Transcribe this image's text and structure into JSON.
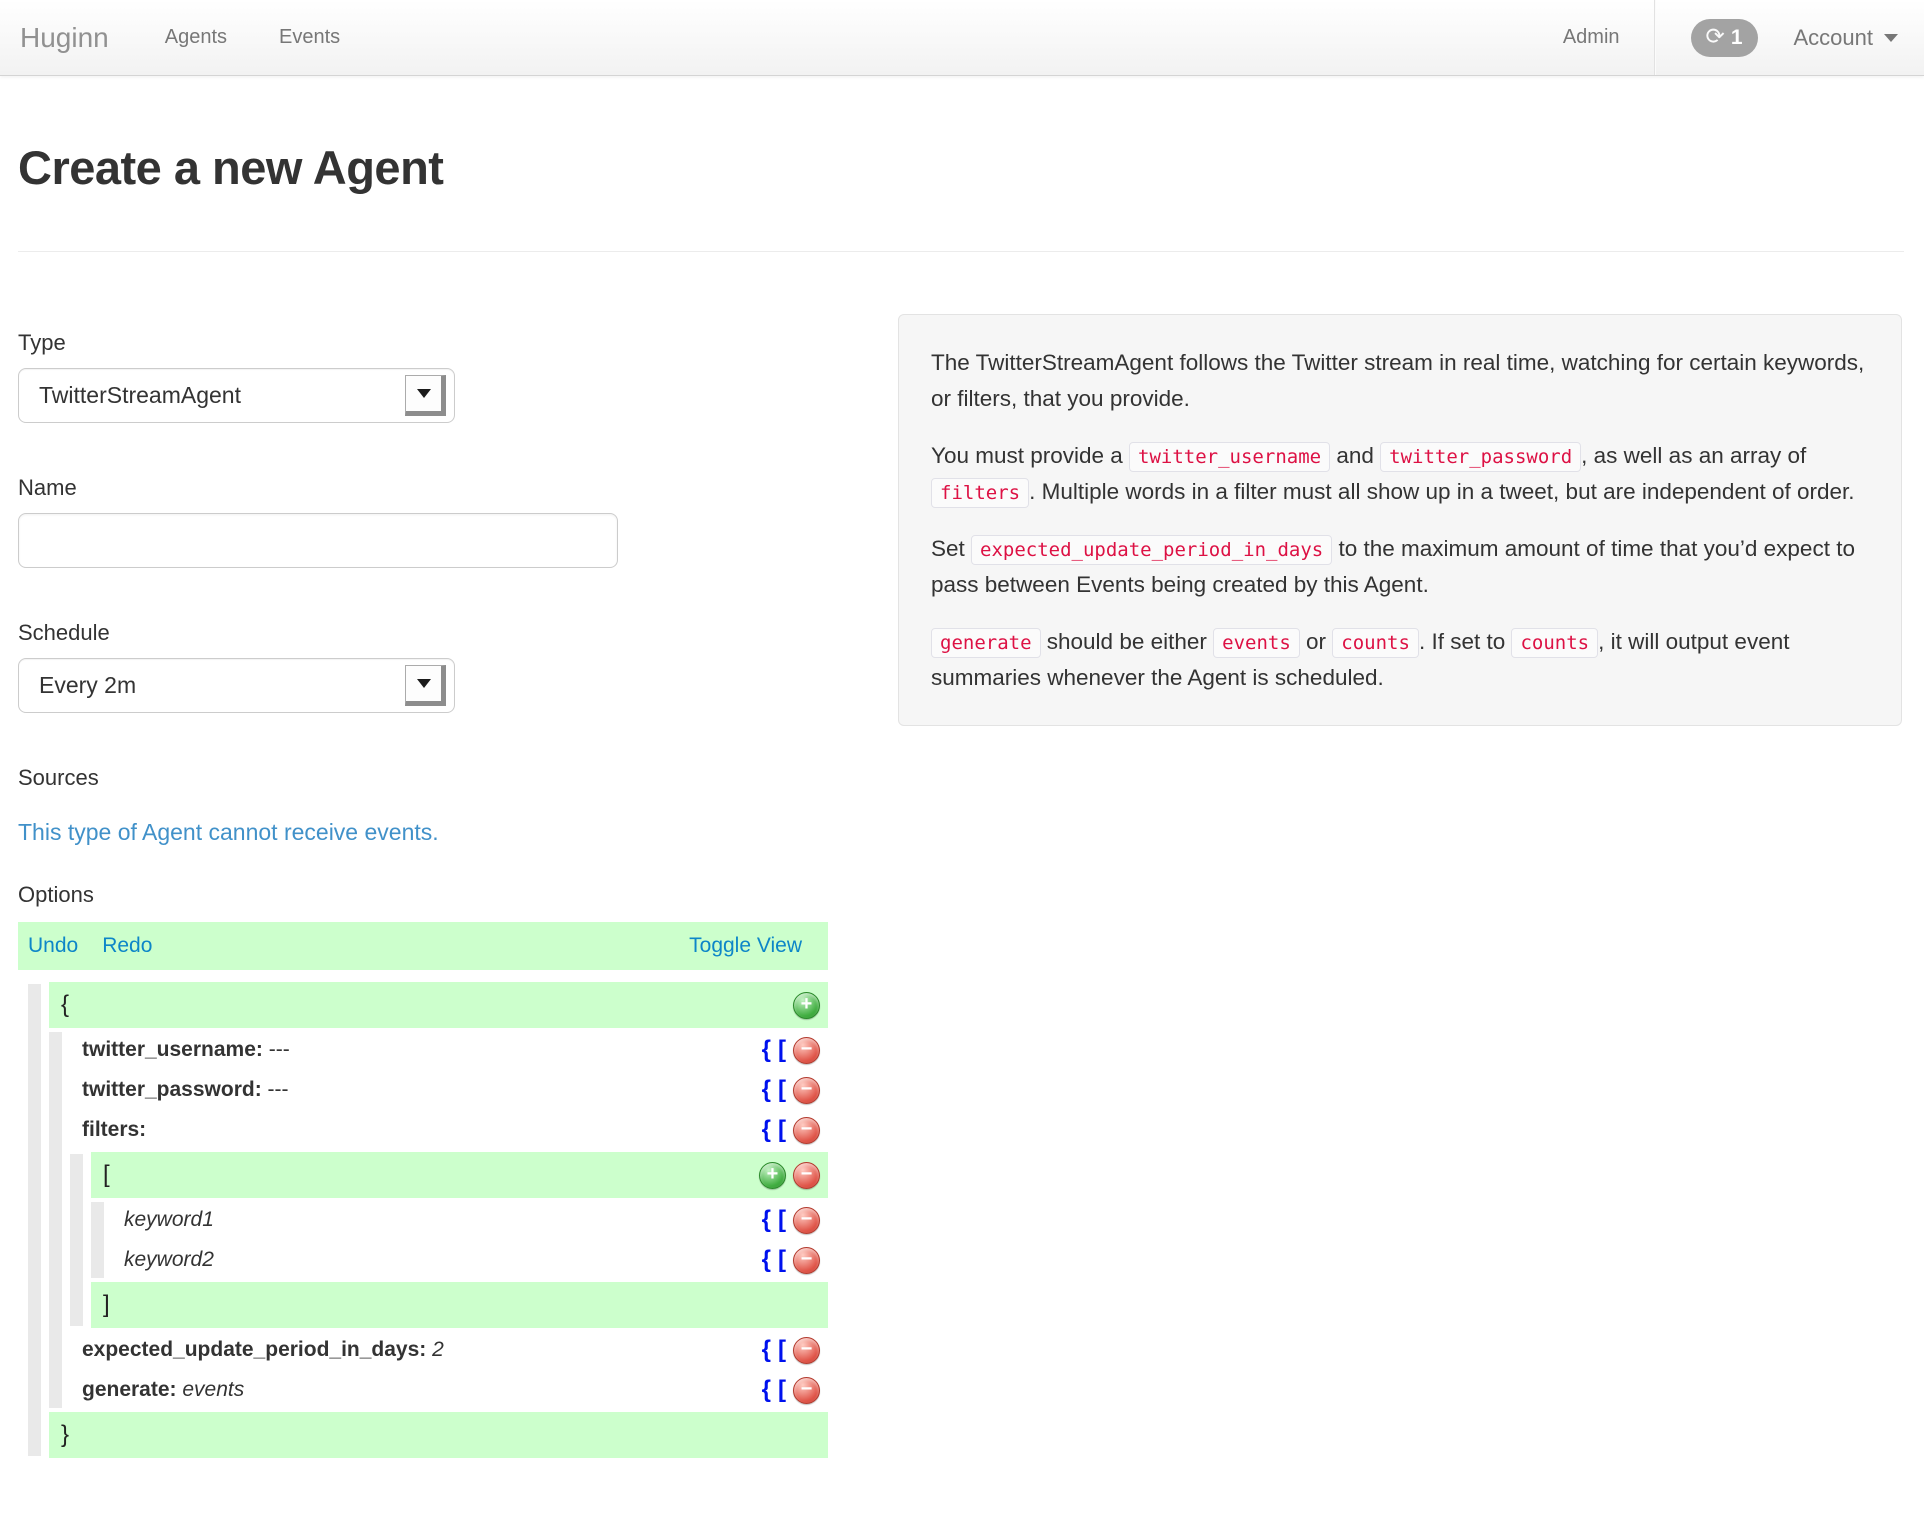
{
  "navbar": {
    "brand": "Huginn",
    "links": {
      "agents": "Agents",
      "events": "Events",
      "admin": "Admin",
      "account": "Account"
    },
    "badge": {
      "icon_glyph": "⟳",
      "count": "1"
    }
  },
  "page": {
    "title": "Create a new Agent"
  },
  "form": {
    "type_label": "Type",
    "type_value": "TwitterStreamAgent",
    "name_label": "Name",
    "name_value": "",
    "schedule_label": "Schedule",
    "schedule_value": "Every 2m",
    "sources_label": "Sources",
    "sources_note": "This type of Agent cannot receive events.",
    "options_label": "Options"
  },
  "editor": {
    "toolbar": {
      "undo": "Undo",
      "redo": "Redo",
      "toggle_view": "Toggle View"
    },
    "rows": [
      {
        "depth": 1,
        "brace": "{",
        "icons": [
          "add"
        ]
      },
      {
        "depth": 2,
        "key": "twitter_username",
        "value": "---",
        "icons": [
          "obj",
          "arr",
          "remove"
        ]
      },
      {
        "depth": 2,
        "key": "twitter_password",
        "value": "---",
        "icons": [
          "obj",
          "arr",
          "remove"
        ]
      },
      {
        "depth": 2,
        "key": "filters",
        "value": "",
        "icons": [
          "obj",
          "arr",
          "remove"
        ]
      },
      {
        "depth": 3,
        "brace": "[",
        "icons": [
          "add",
          "remove"
        ]
      },
      {
        "depth": 4,
        "value": "keyword1",
        "italic": true,
        "icons": [
          "obj",
          "arr",
          "remove"
        ]
      },
      {
        "depth": 4,
        "value": "keyword2",
        "italic": true,
        "icons": [
          "obj",
          "arr",
          "remove"
        ]
      },
      {
        "depth": 3,
        "brace": "]",
        "icons": []
      },
      {
        "depth": 2,
        "key": "expected_update_period_in_days",
        "value": "2",
        "italic": true,
        "icons": [
          "obj",
          "arr",
          "remove"
        ]
      },
      {
        "depth": 2,
        "key": "generate",
        "value": "events",
        "italic": true,
        "icons": [
          "obj",
          "arr",
          "remove"
        ]
      },
      {
        "depth": 1,
        "brace": "}",
        "icons": []
      }
    ]
  },
  "description": {
    "paragraphs": [
      [
        {
          "text": "The TwitterStreamAgent follows the Twitter stream in real time, watching for certain keywords, or filters, that you provide."
        }
      ],
      [
        {
          "text": "You must provide a "
        },
        {
          "code": "twitter_username"
        },
        {
          "text": " and "
        },
        {
          "code": "twitter_password"
        },
        {
          "text": ", as well as an array of "
        },
        {
          "code": "filters"
        },
        {
          "text": ". Multiple words in a filter must all show up in a tweet, but are independent of order."
        }
      ],
      [
        {
          "text": "Set "
        },
        {
          "code": "expected_update_period_in_days"
        },
        {
          "text": " to the maximum amount of time that you’d expect to pass between Events being created by this Agent."
        }
      ],
      [
        {
          "code": "generate"
        },
        {
          "text": " should be either "
        },
        {
          "code": "events"
        },
        {
          "text": " or "
        },
        {
          "code": "counts"
        },
        {
          "text": ". If set to "
        },
        {
          "code": "counts"
        },
        {
          "text": ", it will output event summaries whenever the Agent is scheduled."
        }
      ]
    ]
  },
  "colors": {
    "accent_green": "#ccffcc",
    "link_blue": "#0d86c8",
    "sources_link_blue": "#4191c9",
    "code_red": "#dd1144"
  }
}
